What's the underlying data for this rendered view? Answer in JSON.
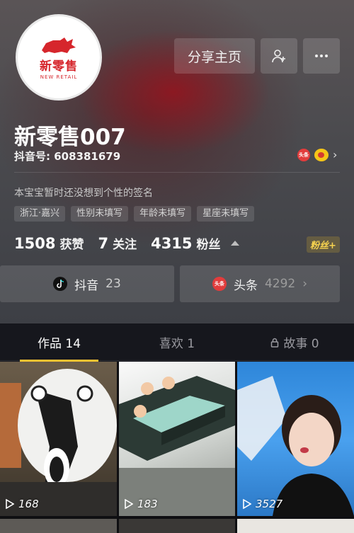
{
  "profile": {
    "avatar_logo_text": "新零售",
    "avatar_logo_sub": "NEW RETAIL",
    "name": "新零售007",
    "douyin_id": "抖音号: 608381679",
    "signature": "本宝宝暂时还没想到个性的签名",
    "tags": [
      "浙江·嘉兴",
      "性别未填写",
      "年龄未填写",
      "星座未填写"
    ]
  },
  "actions": {
    "share_label": "分享主页",
    "follow_icon": "add-user-icon",
    "more_icon": "more-icon"
  },
  "social": {
    "toutiao_badge": "头条"
  },
  "stats": {
    "likes_num": "1508",
    "likes_label": "获赞",
    "following_num": "7",
    "following_label": "关注",
    "fans_num": "4315",
    "fans_label": "粉丝",
    "fan_badge": "粉丝+"
  },
  "links": {
    "douyin_label": "抖音",
    "douyin_count": "23",
    "toutiao_badge": "头条",
    "toutiao_label": "头条",
    "toutiao_count": "4292"
  },
  "tabs": [
    {
      "label": "作品 14",
      "active": true
    },
    {
      "label": "喜欢 1",
      "active": false
    },
    {
      "label": "故事 0",
      "active": false
    }
  ],
  "videos": [
    {
      "plays": "168"
    },
    {
      "plays": "183"
    },
    {
      "plays": "3527"
    }
  ],
  "colors": {
    "accent": "#f7c232",
    "brand_red": "#d6262c",
    "background": "#1b1c22"
  }
}
